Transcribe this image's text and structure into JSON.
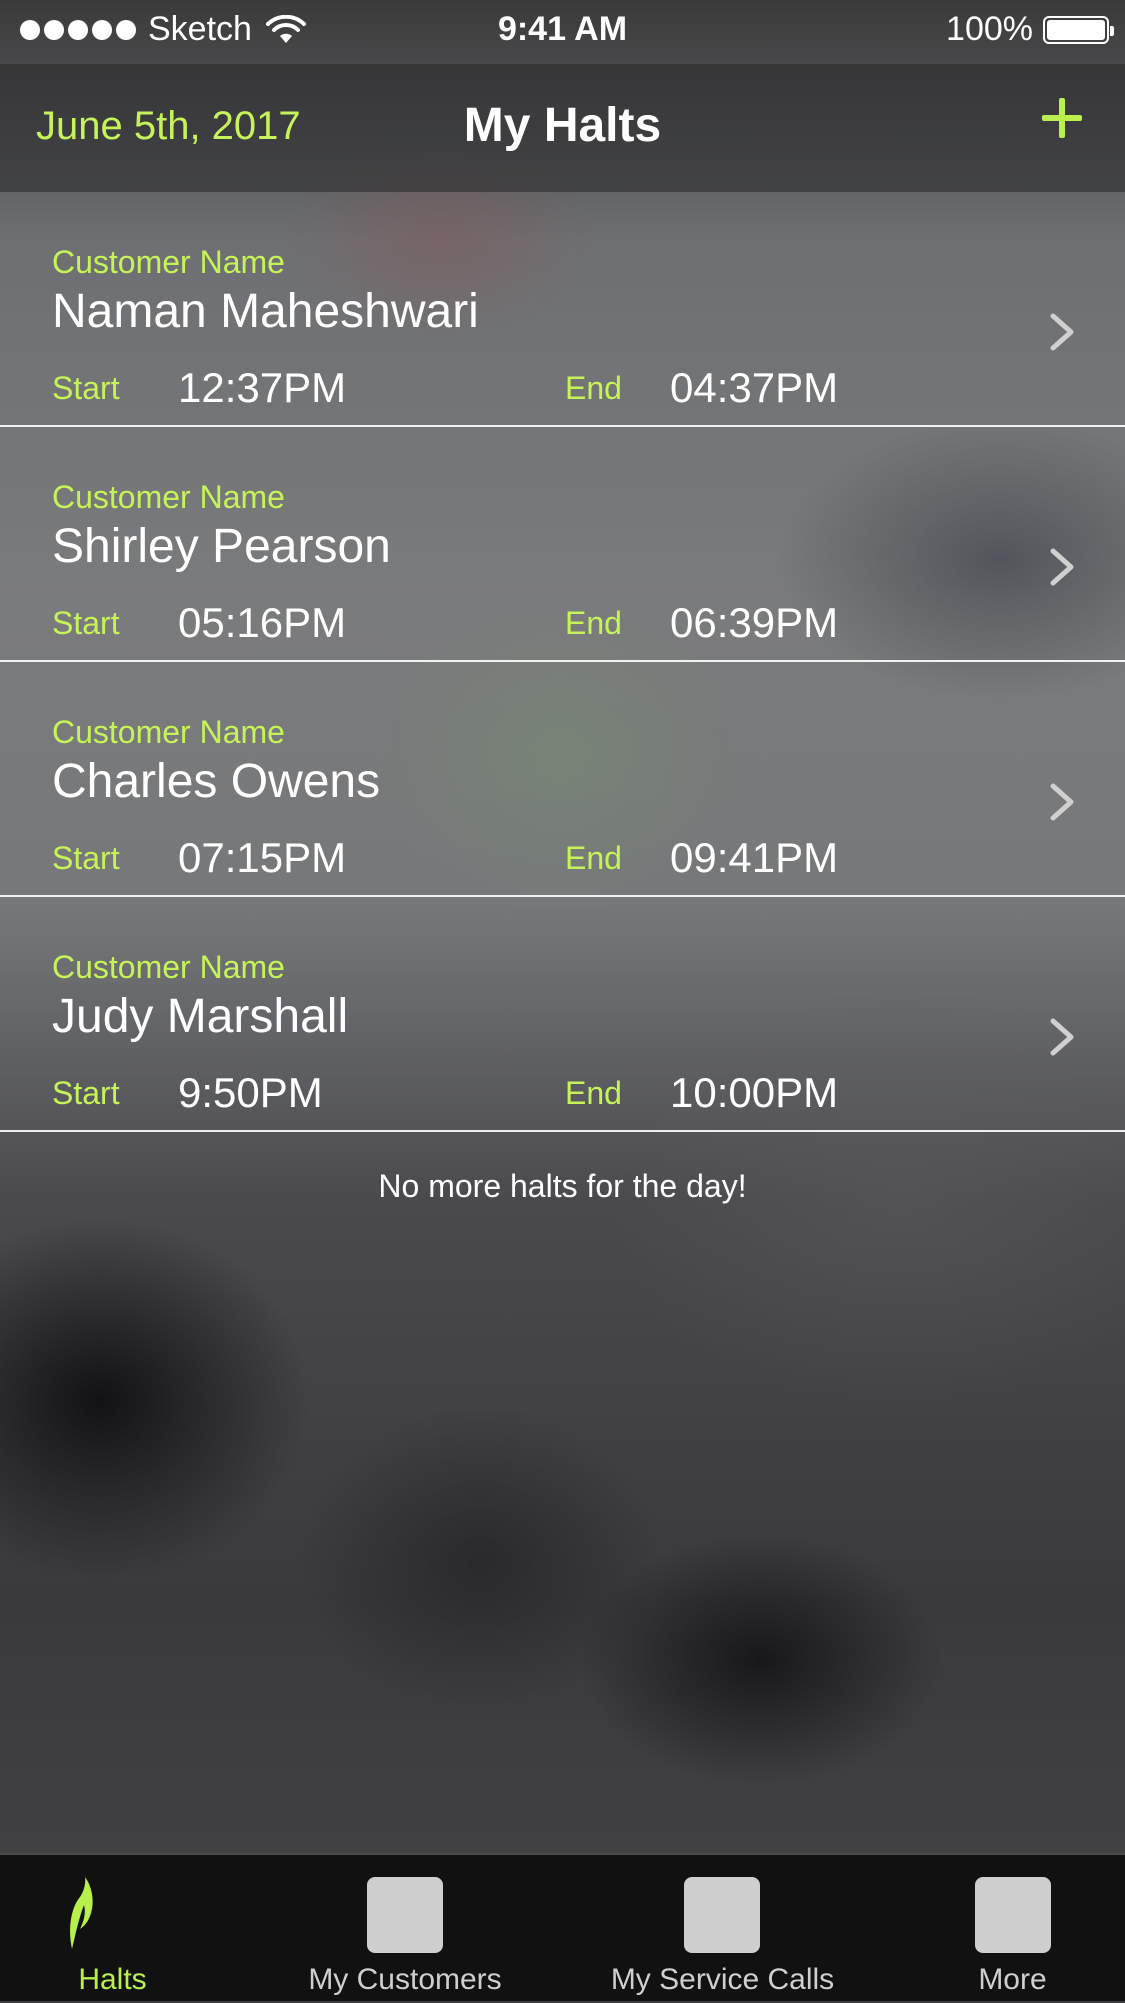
{
  "status_bar": {
    "carrier": "Sketch",
    "time": "9:41 AM",
    "battery_percent": "100%",
    "battery_level": 1.0,
    "signal_bars": 5
  },
  "nav": {
    "date": "June 5th, 2017",
    "title": "My Halts",
    "add_icon": "plus-icon"
  },
  "halts": [
    {
      "label": "Customer Name",
      "name": "Naman Maheshwari",
      "start_label": "Start",
      "start": "12:37PM",
      "end_label": "End",
      "end": "04:37PM"
    },
    {
      "label": "Customer Name",
      "name": "Shirley Pearson",
      "start_label": "Start",
      "start": "05:16PM",
      "end_label": "End",
      "end": "06:39PM"
    },
    {
      "label": "Customer Name",
      "name": "Charles Owens",
      "start_label": "Start",
      "start": "07:15PM",
      "end_label": "End",
      "end": "09:41PM"
    },
    {
      "label": "Customer Name",
      "name": "Judy Marshall",
      "start_label": "Start",
      "start": "9:50PM",
      "end_label": "End",
      "end": "10:00PM"
    }
  ],
  "footer_note": "No more halts for the day!",
  "tabs": [
    {
      "label": "Halts",
      "icon": "halts-leaf-icon",
      "active": true
    },
    {
      "label": "My Customers",
      "icon": "customers-placeholder-icon",
      "active": false
    },
    {
      "label": "My Service Calls",
      "icon": "service-calls-placeholder-icon",
      "active": false
    },
    {
      "label": "More",
      "icon": "more-placeholder-icon",
      "active": false
    }
  ],
  "colors": {
    "accent": "#c6f25a",
    "text": "#ffffff",
    "tab_inactive": "#cfcfcf",
    "tabbar_bg": "#111112"
  }
}
